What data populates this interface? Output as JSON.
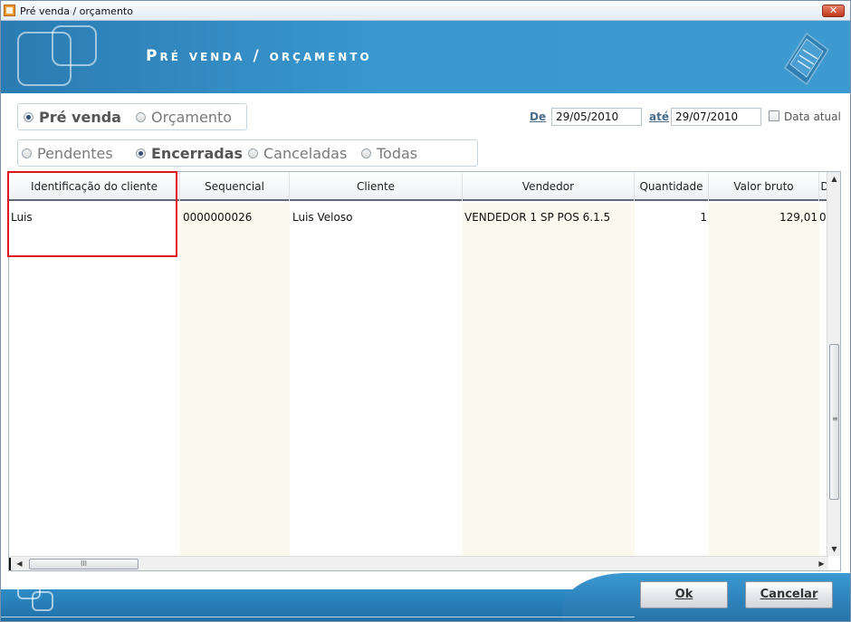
{
  "window": {
    "title": "Pré venda / orçamento",
    "close_label": "✕"
  },
  "banner": {
    "title": "Pré venda / orçamento"
  },
  "type_filter": {
    "options": [
      {
        "label": "Pré venda",
        "selected": true
      },
      {
        "label": "Orçamento",
        "selected": false
      }
    ]
  },
  "status_filter": {
    "options": [
      {
        "label": "Pendentes",
        "selected": false
      },
      {
        "label": "Encerradas",
        "selected": true
      },
      {
        "label": "Canceladas",
        "selected": false
      },
      {
        "label": "Todas",
        "selected": false
      }
    ]
  },
  "date_range": {
    "from_label": "De",
    "from_value": "29/05/2010",
    "to_label": "até",
    "to_value": "29/07/2010",
    "current_date_label": "Data atual",
    "current_date_checked": false
  },
  "grid": {
    "columns": [
      "Identificação do cliente",
      "Sequencial",
      "Cliente",
      "Vendedor",
      "Quantidade",
      "Valor bruto",
      "D"
    ],
    "rows": [
      {
        "identificacao": "Luis",
        "sequencial": "0000000026",
        "cliente": "Luis Veloso",
        "vendedor": "VENDEDOR 1 SP POS 6.1.5",
        "quantidade": "1",
        "valor_bruto": "129,01",
        "d": "0"
      }
    ],
    "scroll": {
      "up": "▲",
      "down": "▼",
      "left": "◀",
      "right": "▶",
      "grip_h": "III",
      "grip_v": "≡"
    }
  },
  "buttons": {
    "ok": "Ok",
    "cancel": "Cancelar"
  },
  "colors": {
    "banner": "#3a97cf",
    "highlight": "#e0141c"
  }
}
